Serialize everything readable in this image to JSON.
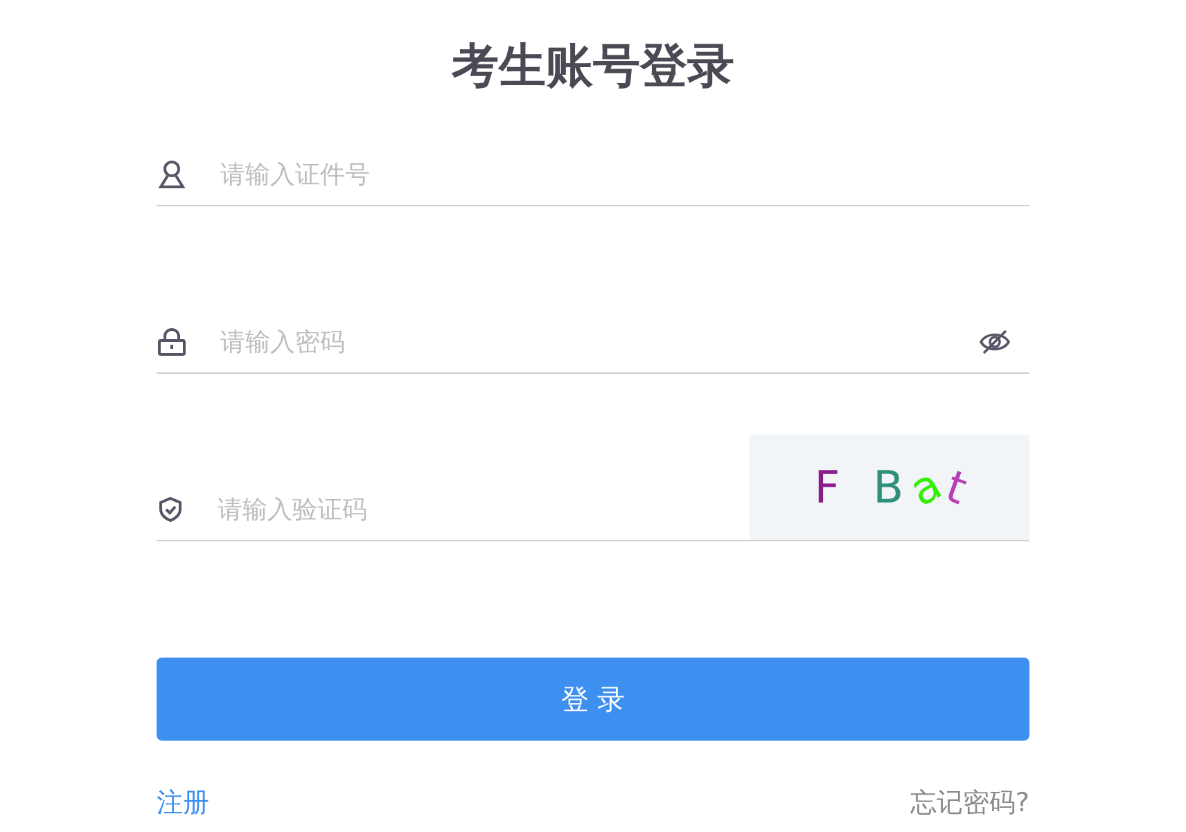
{
  "title": "考生账号登录",
  "fields": [
    {
      "kind": "id",
      "placeholder": "请输入证件号"
    },
    {
      "kind": "password",
      "placeholder": "请输入密码",
      "password_visible": false
    },
    {
      "kind": "captcha",
      "placeholder": "请输入验证码",
      "captcha": [
        {
          "char": "F",
          "color": "#8b1a8b"
        },
        {
          "char": "B",
          "color": "#2e8f7a"
        },
        {
          "char": "a",
          "color": "#33ee00"
        },
        {
          "char": "t",
          "color": "#b53fb5"
        }
      ]
    }
  ],
  "login_button": "登 录",
  "register_link": "注册",
  "forgot_link": "忘记密码?"
}
